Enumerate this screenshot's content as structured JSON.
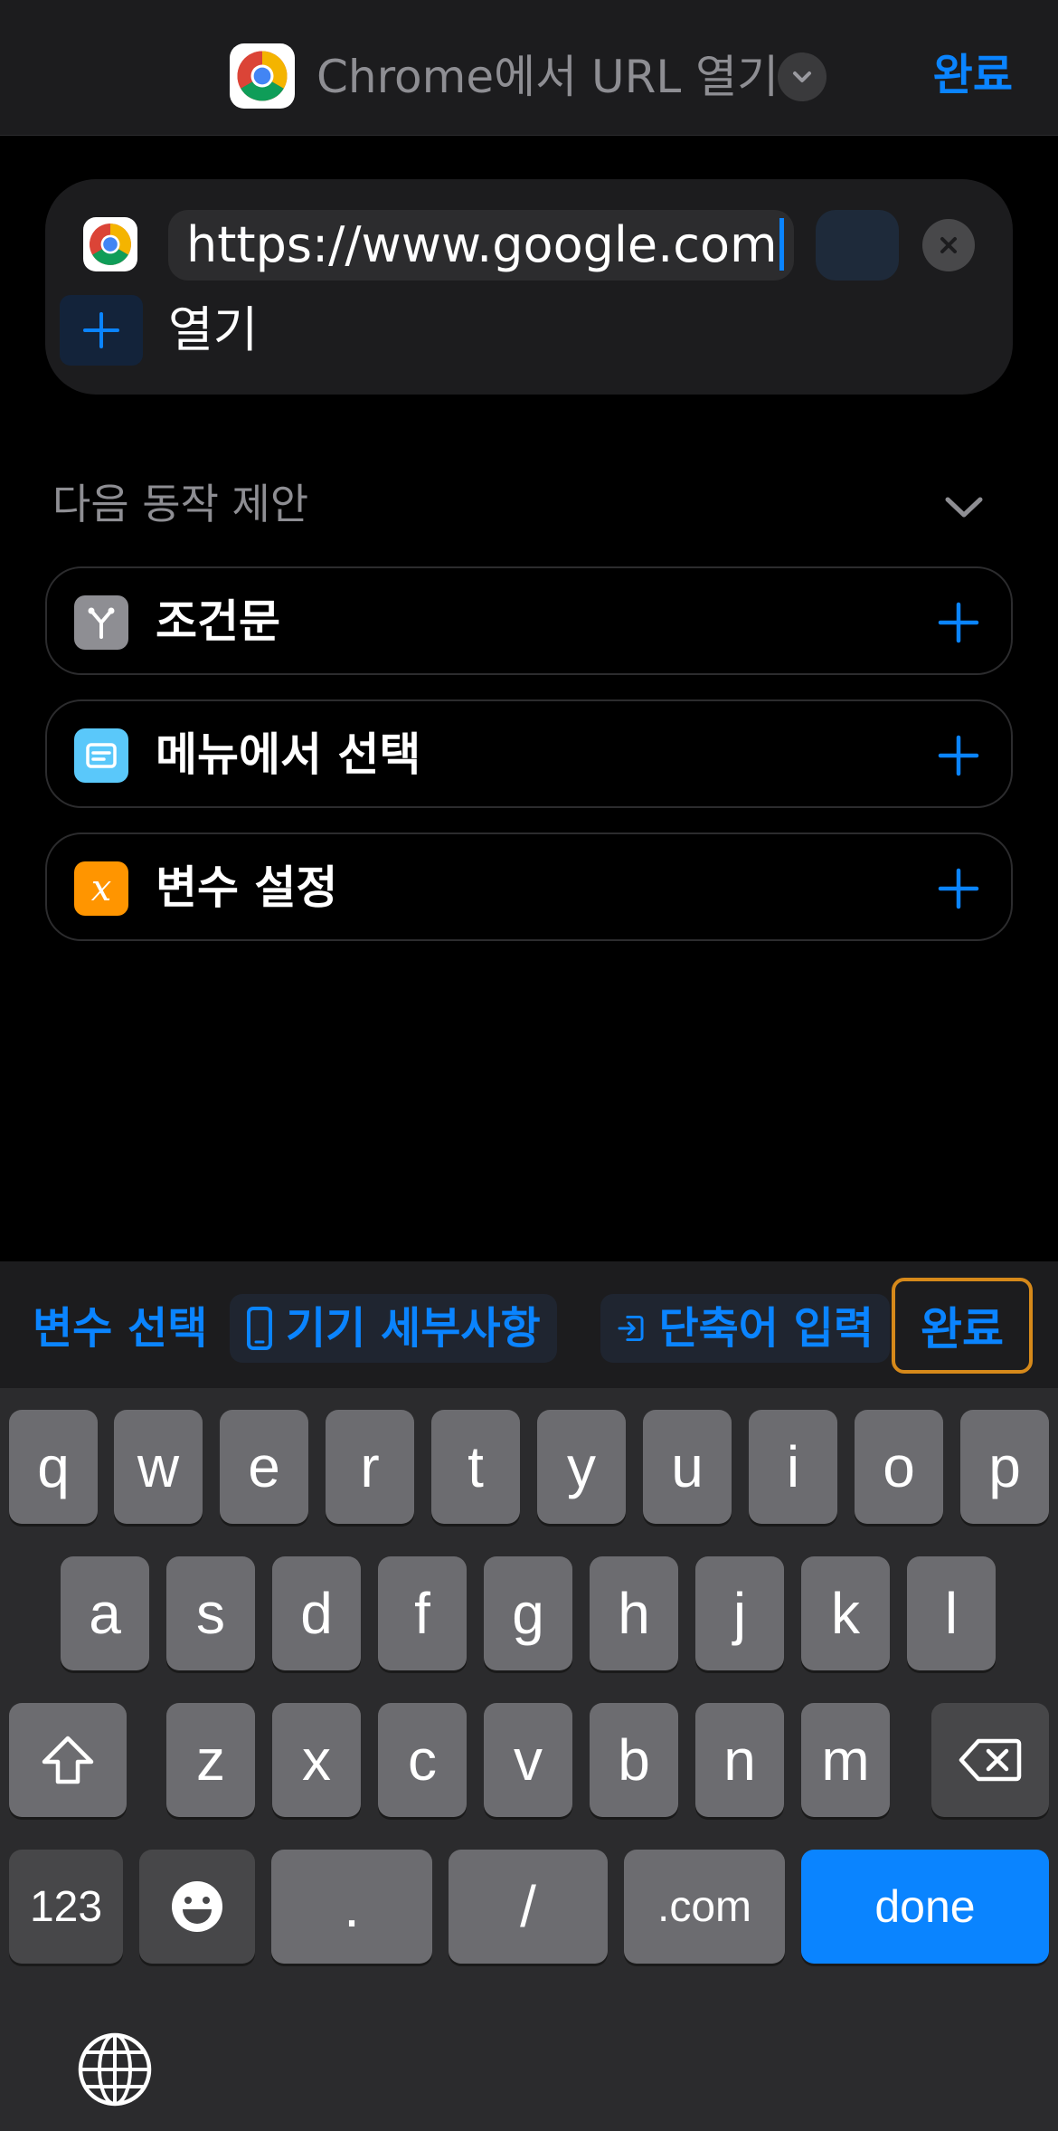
{
  "navbar": {
    "title": "Chrome에서 URL 열기",
    "done_label": "완료"
  },
  "action_card": {
    "url_value": "https://www.google.com",
    "open_label": "열기"
  },
  "suggestions": {
    "header": "다음 동작 제안",
    "items": [
      {
        "label": "조건문",
        "icon": "branch-icon",
        "color": "#8e8e93"
      },
      {
        "label": "메뉴에서 선택",
        "icon": "menu-icon",
        "color": "#5ac8fa"
      },
      {
        "label": "변수 설정",
        "icon": "variable-icon",
        "color": "#ff9500",
        "glyph": "x"
      }
    ]
  },
  "accessory": {
    "select_variable": "변수 선택",
    "device_details": "기기 세부사항",
    "shortcut_input": "단축어 입력",
    "done_label": "완료"
  },
  "keyboard": {
    "row1": [
      "q",
      "w",
      "e",
      "r",
      "t",
      "y",
      "u",
      "i",
      "o",
      "p"
    ],
    "row2": [
      "a",
      "s",
      "d",
      "f",
      "g",
      "h",
      "j",
      "k",
      "l"
    ],
    "row3": [
      "z",
      "x",
      "c",
      "v",
      "b",
      "n",
      "m"
    ],
    "numbers_label": "123",
    "dot_label": ".",
    "slash_label": "/",
    "dotcom_label": ".com",
    "done_label": "done"
  },
  "colors": {
    "accent": "#0a84ff",
    "highlight_border": "#d6891a"
  }
}
